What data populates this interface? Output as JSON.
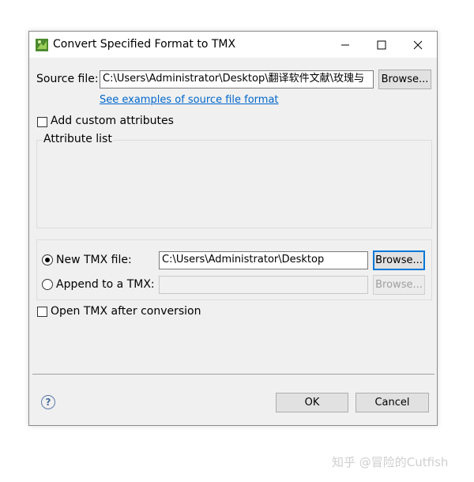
{
  "window": {
    "title": "Convert Specified Format to TMX",
    "icon": "convert-app-icon",
    "controls": [
      "minimize-icon",
      "maximize-icon",
      "close-icon"
    ]
  },
  "source": {
    "label": "Source file:",
    "value": "C:\\Users\\Administrator\\Desktop\\翻译软件文献\\玫瑰与",
    "browse_label": "Browse...",
    "examples_link": "See examples of source file format"
  },
  "attributes": {
    "checkbox_label": "Add custom attributes",
    "checked": false,
    "list_label": "Attribute list"
  },
  "output": {
    "new_label": "New TMX file:",
    "new_value": "C:\\Users\\Administrator\\Desktop",
    "new_selected": true,
    "new_browse_label": "Browse...",
    "append_label": "Append to a TMX:",
    "append_value": "",
    "append_browse_label": "Browse..."
  },
  "open_after": {
    "label": "Open TMX after conversion",
    "checked": false
  },
  "footer": {
    "ok_label": "OK",
    "cancel_label": "Cancel",
    "help_icon": "help-icon"
  },
  "watermark": "知乎 @冒险的Cutfish",
  "colors": {
    "dialog_bg": "#f0f0f0",
    "link": "#0066cc",
    "focus": "#0078d7"
  }
}
